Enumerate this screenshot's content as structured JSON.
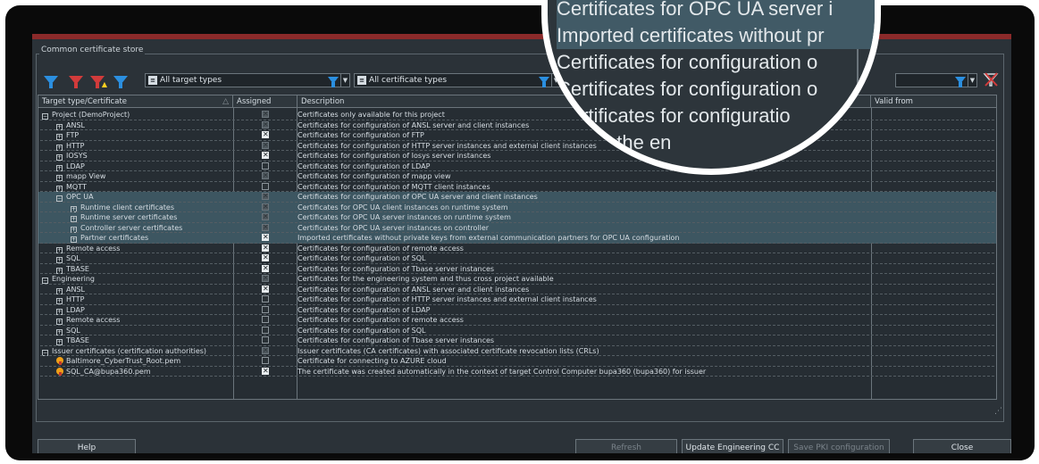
{
  "window": {
    "group_title": "Common certificate store"
  },
  "toolbar": {
    "icons": [
      "filter-icon",
      "filter-red-icon",
      "filter-warning-icon",
      "filter-remove-icon"
    ],
    "target_type_filter": "All target types",
    "certificate_type_filter": "All certificate types",
    "clear_filter_icon": "clear-filter-icon"
  },
  "table": {
    "headers": {
      "col1": "Target type/Certificate",
      "col2": "Assigned",
      "col3": "Description",
      "col4": "Valid from"
    },
    "rows": [
      {
        "indent": 0,
        "expander": "−",
        "name": "Project (DemoProject)",
        "assigned": "dim",
        "desc": "Certificates only available for this project"
      },
      {
        "indent": 1,
        "expander": "+",
        "name": "ANSL",
        "assigned": "dim",
        "desc": "Certificates for configuration of ANSL server and client instances"
      },
      {
        "indent": 1,
        "expander": "+",
        "name": "FTP",
        "assigned": "on",
        "desc": "Certificates for configuration of FTP"
      },
      {
        "indent": 1,
        "expander": "+",
        "name": "HTTP",
        "assigned": "dim",
        "desc": "Certificates for configuration of HTTP server instances and external client instances"
      },
      {
        "indent": 1,
        "expander": "+",
        "name": "IOSYS",
        "assigned": "on",
        "desc": "Certificates for configuration of Iosys server instances"
      },
      {
        "indent": 1,
        "expander": "+",
        "name": "LDAP",
        "assigned": "off",
        "desc": "Certificates for configuration of LDAP"
      },
      {
        "indent": 1,
        "expander": "+",
        "name": "mapp View",
        "assigned": "dim",
        "desc": "Certificates for configuration of mapp view"
      },
      {
        "indent": 1,
        "expander": "+",
        "name": "MQTT",
        "assigned": "off",
        "desc": "Certificates for configuration of MQTT client instances"
      },
      {
        "indent": 1,
        "expander": "−",
        "name": "OPC UA",
        "assigned": "dim",
        "desc": "Certificates for configuration of OPC UA server and client instances",
        "selected": true
      },
      {
        "indent": 2,
        "expander": "+",
        "name": "Runtime client certificates",
        "assigned": "dim",
        "desc": "Certificates for OPC UA client instances on runtime system",
        "selected": true
      },
      {
        "indent": 2,
        "expander": "+",
        "name": "Runtime server certificates",
        "assigned": "dim",
        "desc": "Certificates for OPC UA server instances on runtime system",
        "selected": true
      },
      {
        "indent": 2,
        "expander": "+",
        "name": "Controller server certificates",
        "assigned": "dim",
        "desc": "Certificates for OPC UA server instances on controller",
        "selected": true
      },
      {
        "indent": 2,
        "expander": "+",
        "name": "Partner certificates",
        "assigned": "on",
        "desc": "Imported certificates without private keys from external communication partners for OPC UA configuration",
        "selected": true
      },
      {
        "indent": 1,
        "expander": "+",
        "name": "Remote access",
        "assigned": "on",
        "desc": "Certificates for configuration of remote access"
      },
      {
        "indent": 1,
        "expander": "+",
        "name": "SQL",
        "assigned": "on",
        "desc": "Certificates for configuration of SQL"
      },
      {
        "indent": 1,
        "expander": "+",
        "name": "TBASE",
        "assigned": "on",
        "desc": "Certificates for configuration of Tbase server instances"
      },
      {
        "indent": 0,
        "expander": "−",
        "name": "Engineering",
        "assigned": "dim",
        "desc": "Certificates for the engineering system and thus cross project available"
      },
      {
        "indent": 1,
        "expander": "+",
        "name": "ANSL",
        "assigned": "on",
        "desc": "Certificates for configuration of ANSL server and client instances"
      },
      {
        "indent": 1,
        "expander": "+",
        "name": "HTTP",
        "assigned": "off",
        "desc": "Certificates for configuration of HTTP server instances and external client instances"
      },
      {
        "indent": 1,
        "expander": "+",
        "name": "LDAP",
        "assigned": "off",
        "desc": "Certificates for configuration of LDAP"
      },
      {
        "indent": 1,
        "expander": "+",
        "name": "Remote access",
        "assigned": "off",
        "desc": "Certificates for configuration of remote access"
      },
      {
        "indent": 1,
        "expander": "+",
        "name": "SQL",
        "assigned": "off",
        "desc": "Certificates for configuration of SQL"
      },
      {
        "indent": 1,
        "expander": "+",
        "name": "TBASE",
        "assigned": "off",
        "desc": "Certificates for configuration of Tbase server instances"
      },
      {
        "indent": 0,
        "expander": "−",
        "name": "Issuer certificates (certification authorities)",
        "assigned": "dim",
        "desc": "Issuer certificates (CA certificates) with associated certificate revocation lists (CRLs)"
      },
      {
        "indent": 1,
        "expander": "cert",
        "name": "Baltimore_CyberTrust_Root.pem",
        "assigned": "off",
        "desc": "Certificate for connecting to AZURE cloud"
      },
      {
        "indent": 1,
        "expander": "cert",
        "name": "SQL_CA@bupa360.pem",
        "assigned": "on",
        "desc": "The certificate was created automatically in the context of target Control Computer bupa360 (bupa360) for  issuer"
      }
    ]
  },
  "buttons": {
    "help": "Help",
    "refresh": "Refresh",
    "update_engineering": "Update Engineering CC",
    "save_pki": "Save PKI configuration",
    "close": "Close"
  },
  "magnifier": {
    "lines": [
      "Certificates for OPC UA server i",
      "Certificates for OPC UA server i",
      "Imported certificates without pr",
      "Certificates for configuration o",
      "Certificates for configuration o",
      "Certificates for configuratio",
      "tes for the en"
    ]
  },
  "colors": {
    "background": "#2b3238",
    "selection": "#3d5661",
    "filter_blue": "#2b8fe0",
    "filter_red": "#d23b3b"
  }
}
